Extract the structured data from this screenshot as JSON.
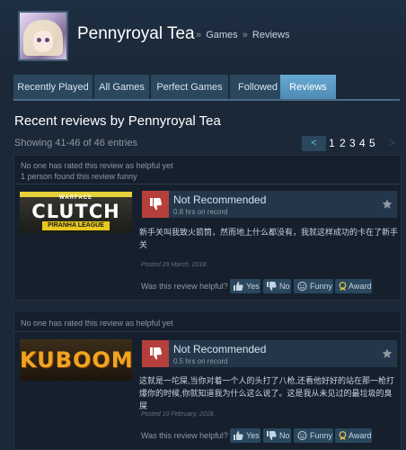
{
  "profile": {
    "name": "Pennyroyal Tea",
    "breadcrumb": [
      "Games",
      "Reviews"
    ],
    "breadcrumb_sep": "»"
  },
  "tabs": [
    {
      "label": "Recently Played",
      "active": false
    },
    {
      "label": "All Games",
      "active": false
    },
    {
      "label": "Perfect Games",
      "active": false
    },
    {
      "label": "Followed",
      "active": false
    },
    {
      "label": "Reviews",
      "active": true
    }
  ],
  "page": {
    "title": "Recent reviews by Pennyroyal Tea",
    "showing": "Showing 41-46 of 46 entries"
  },
  "pagination": {
    "prev": "<",
    "pages": [
      "1",
      "2",
      "3",
      "4",
      "5"
    ],
    "next": ">"
  },
  "reviews": [
    {
      "helpful_line1": "No one has rated this review as helpful yet",
      "helpful_line2": "1 person found this review funny",
      "game": {
        "name": "Warface Clutch Piranha League",
        "line1": "WARFACE",
        "line2": "CLUTCH",
        "line3": "PIRANHA LEAGUE"
      },
      "recommendation": "Not Recommended",
      "hours": "0.8 hrs on record",
      "text": "新手关叫我致火箭筒，然而地上什么都没有，我就这样成功的卡在了新手关",
      "posted": "Posted 29 March, 2018.",
      "rate_label": "Was this review helpful?",
      "buttons": {
        "yes": "Yes",
        "no": "No",
        "funny": "Funny",
        "award": "Award"
      }
    },
    {
      "helpful_line1": "No one has rated this review as helpful yet",
      "game": {
        "name": "KUBOOM",
        "line1": "KUBOOM"
      },
      "recommendation": "Not Recommended",
      "hours": "0.5 hrs on record",
      "text": "这就是一坨屎,当你对着一个人的头打了八枪,还看他好好的站在那一枪打爆你的时候,你就知道我为什么这么说了。这是我从未见过的最垃圾的臭屎",
      "posted": "Posted 10 February, 2018.",
      "rate_label": "Was this review helpful?",
      "buttons": {
        "yes": "Yes",
        "no": "No",
        "funny": "Funny",
        "award": "Award"
      }
    }
  ],
  "colors": {
    "background": "#1b2838",
    "tab": "#2a475e",
    "tab_active": "#67a9d3",
    "thumb_down": "#b5403b",
    "link": "#66c0f4"
  },
  "icons": [
    "thumbs-down-icon",
    "thumbs-up-icon",
    "star-icon",
    "smiley-icon",
    "award-icon"
  ]
}
